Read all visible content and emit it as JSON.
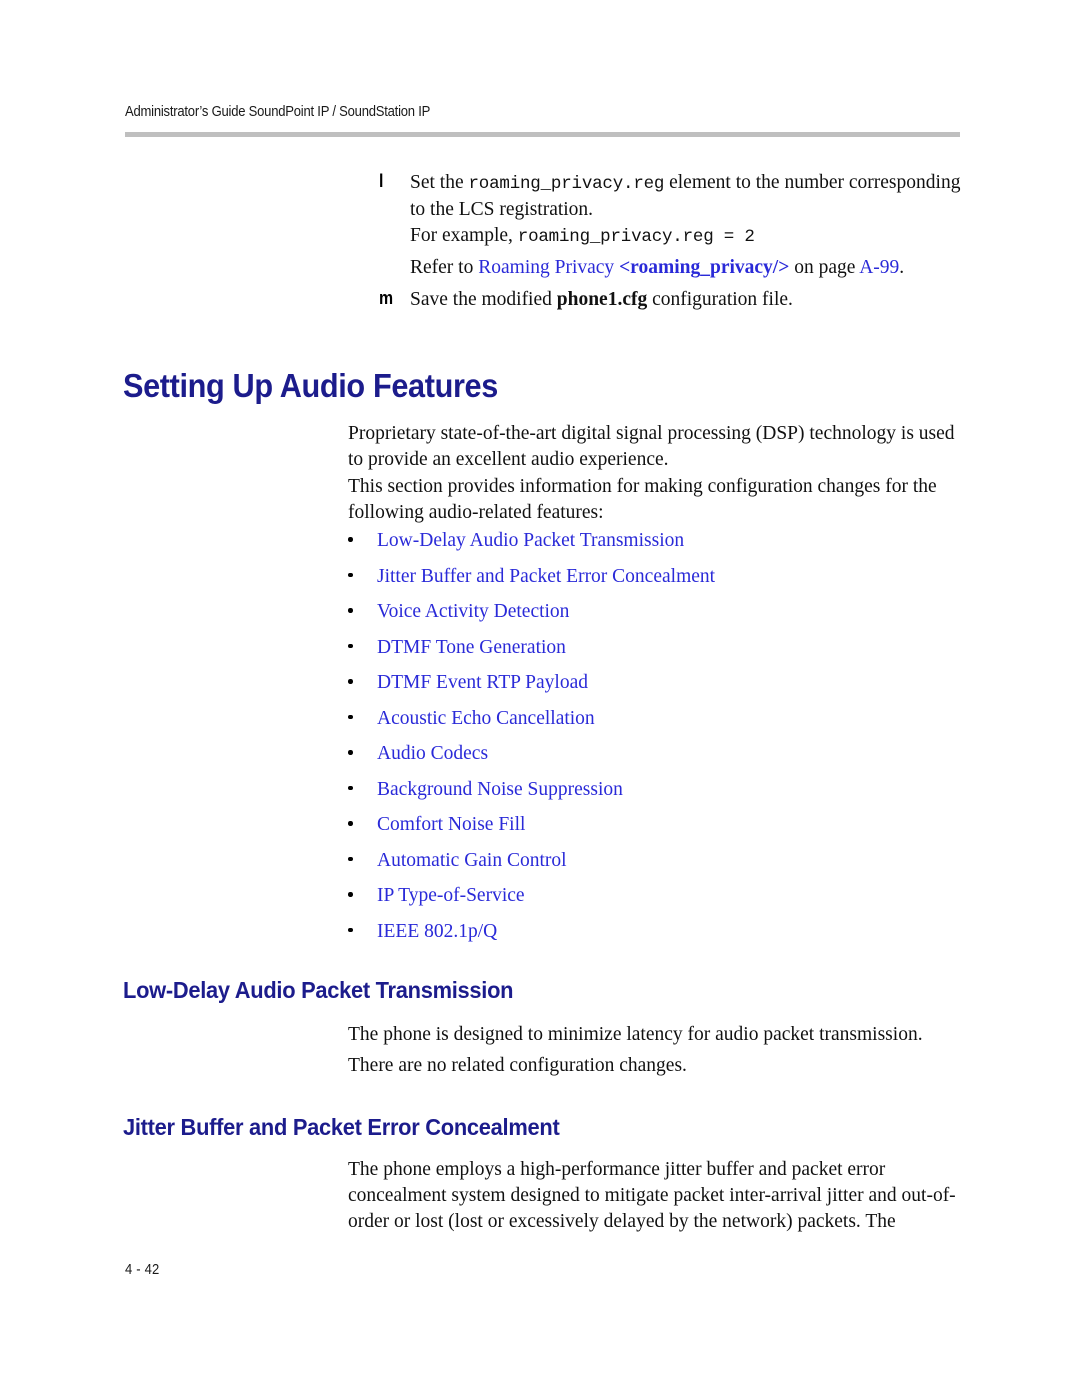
{
  "page": {
    "header": "Administrator’s Guide SoundPoint IP / SoundStation IP",
    "footer_page_number": "4 - 42",
    "rule_color": "#bfbfbf",
    "heading_color": "#1c1c8c",
    "link_color": "#2a2ad8"
  },
  "steps": [
    {
      "marker": "l",
      "text_before": "Set the ",
      "mono": "roaming_privacy.reg",
      "text_after": " element to the number corresponding to the LCS registration."
    },
    {
      "marker": "m",
      "text_before": "Save the modified ",
      "bold": "phone1.cfg",
      "text_after": " configuration file."
    }
  ],
  "example_line": {
    "prefix": "For example, ",
    "mono": "roaming_privacy.reg = 2"
  },
  "refer_line": {
    "prefix": "Refer to ",
    "link_text": "Roaming Privacy ",
    "link_bold": "<roaming_privacy/>",
    "middle": " on page ",
    "page_link": "A-99",
    "suffix": "."
  },
  "section": {
    "title": "Setting Up Audio Features",
    "intro_paragraph_1": "Proprietary state-of-the-art digital signal processing (DSP) technology is used to provide an excellent audio experience.",
    "intro_paragraph_2": "This section provides information for making configuration changes for the following audio-related features:",
    "feature_links": [
      "Low-Delay Audio Packet Transmission",
      "Jitter Buffer and Packet Error Concealment",
      "Voice Activity Detection",
      "DTMF Tone Generation",
      "DTMF Event RTP Payload",
      "Acoustic Echo Cancellation",
      "Audio Codecs",
      "Background Noise Suppression",
      "Comfort Noise Fill",
      "Automatic Gain Control",
      "IP Type-of-Service",
      "IEEE 802.1p/Q"
    ]
  },
  "subsections": [
    {
      "title": "Low-Delay Audio Packet Transmission",
      "paragraph_1": "The phone is designed to minimize latency for audio packet transmission.",
      "paragraph_2": "There are no related configuration changes."
    },
    {
      "title": "Jitter Buffer and Packet Error Concealment",
      "paragraph_1": "The phone employs a high-performance jitter buffer and packet error concealment system designed to mitigate packet inter-arrival jitter and out-of-order or lost (lost or excessively delayed by the network) packets. The"
    }
  ]
}
